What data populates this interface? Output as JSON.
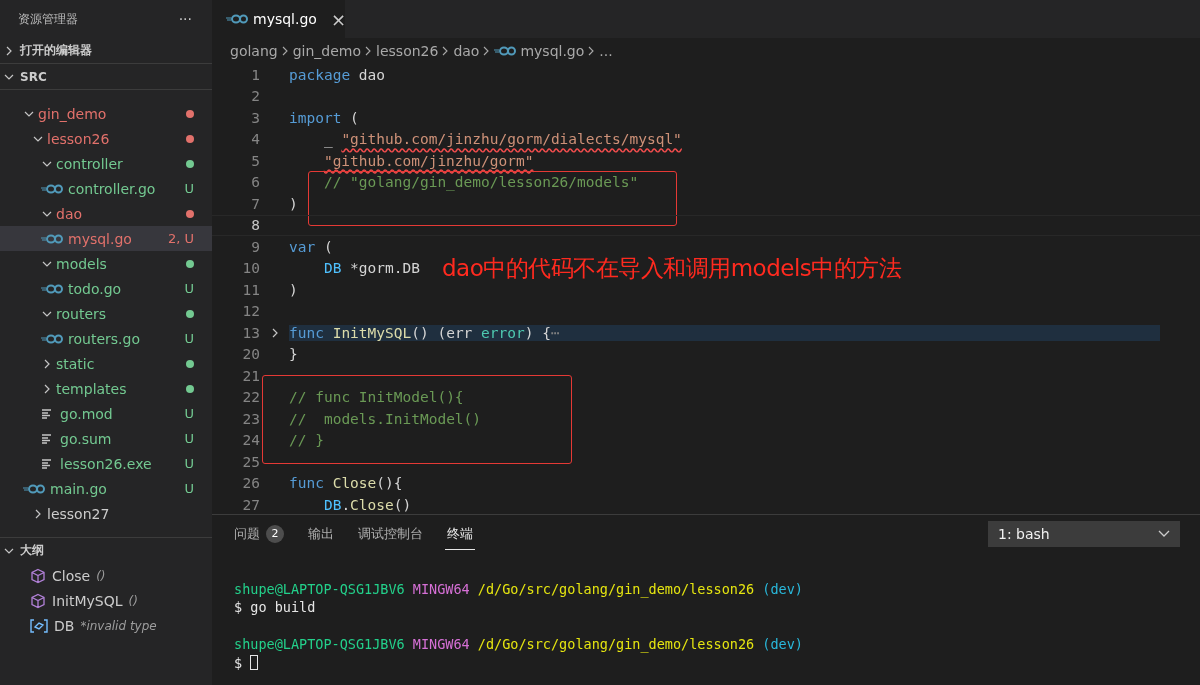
{
  "sidebar": {
    "title": "资源管理器",
    "more": "···",
    "sections": [
      {
        "label": "打开的编辑器",
        "expanded": false
      },
      {
        "label": "SRC",
        "expanded": true
      }
    ],
    "tree": [
      {
        "label": "gin_demo",
        "kind": "folder",
        "expanded": true,
        "color": "#e2716b",
        "dot": true,
        "children": [
          {
            "label": "lesson26",
            "kind": "folder",
            "expanded": true,
            "color": "#e2716b",
            "dot": true,
            "children": [
              {
                "label": "controller",
                "kind": "folder",
                "expanded": true,
                "color": "#73c991",
                "dot": true,
                "children": [
                  {
                    "label": "controller.go",
                    "kind": "go",
                    "color": "#73c991",
                    "badge": "U",
                    "selected": false
                  }
                ]
              },
              {
                "label": "dao",
                "kind": "folder",
                "expanded": true,
                "color": "#e2716b",
                "dot": true,
                "children": [
                  {
                    "label": "mysql.go",
                    "kind": "go",
                    "color": "#e2716b",
                    "badge": "2, U",
                    "selected": true
                  }
                ]
              },
              {
                "label": "models",
                "kind": "folder",
                "expanded": true,
                "color": "#73c991",
                "dot": true,
                "children": [
                  {
                    "label": "todo.go",
                    "kind": "go",
                    "color": "#73c991",
                    "badge": "U",
                    "selected": false
                  }
                ]
              },
              {
                "label": "routers",
                "kind": "folder",
                "expanded": true,
                "color": "#73c991",
                "dot": true,
                "children": [
                  {
                    "label": "routers.go",
                    "kind": "go",
                    "color": "#73c991",
                    "badge": "U",
                    "selected": false
                  }
                ]
              },
              {
                "label": "static",
                "kind": "folder",
                "expanded": false,
                "color": "#73c991",
                "dot": true
              },
              {
                "label": "templates",
                "kind": "folder",
                "expanded": false,
                "color": "#73c991",
                "dot": true
              },
              {
                "label": "go.mod",
                "kind": "file",
                "color": "#73c991",
                "badge": "U",
                "selected": false
              },
              {
                "label": "go.sum",
                "kind": "file",
                "color": "#73c991",
                "badge": "U",
                "selected": false
              },
              {
                "label": "lesson26.exe",
                "kind": "file",
                "color": "#73c991",
                "badge": "U",
                "selected": false
              }
            ]
          },
          {
            "label": "main.go",
            "kind": "go",
            "color": "#73c991",
            "badge": "U",
            "selected": false
          },
          {
            "label": "lesson27",
            "kind": "folder",
            "expanded": false
          }
        ]
      }
    ],
    "outline": {
      "label": "大纲",
      "expanded": true,
      "items": [
        {
          "name": "Close",
          "detail": "()",
          "kind": "method"
        },
        {
          "name": "InitMySQL",
          "detail": "()",
          "kind": "method"
        },
        {
          "name": "DB",
          "detail": "*invalid type",
          "kind": "variable"
        }
      ]
    }
  },
  "editor": {
    "tab": {
      "label": "mysql.go",
      "close": "×"
    },
    "breadcrumbs": [
      {
        "label": "golang",
        "kind": "folder"
      },
      {
        "label": "gin_demo",
        "kind": "folder"
      },
      {
        "label": "lesson26",
        "kind": "folder"
      },
      {
        "label": "dao",
        "kind": "folder"
      },
      {
        "label": "mysql.go",
        "kind": "go"
      },
      {
        "label": "...",
        "kind": "more"
      }
    ],
    "lines": [
      {
        "number": "1",
        "tokens": [
          {
            "text": "package",
            "kind": "keyword"
          },
          {
            "text": " dao",
            "kind": "plain"
          }
        ]
      },
      {
        "number": "2"
      },
      {
        "number": "3",
        "tokens": [
          {
            "text": "import",
            "kind": "keyword"
          },
          {
            "text": " (",
            "kind": "plain"
          }
        ]
      },
      {
        "number": "4",
        "indented": true,
        "tokens": [
          {
            "text": "_ ",
            "kind": "plain"
          },
          {
            "text": "\"github.com/jinzhu/gorm/dialects/mysql\"",
            "kind": "string",
            "error": true
          }
        ]
      },
      {
        "number": "5",
        "indented": true,
        "tokens": [
          {
            "text": "\"github.com/jinzhu/gorm\"",
            "kind": "string",
            "error": true
          }
        ]
      },
      {
        "number": "6",
        "boxed": true,
        "indented": true,
        "tokens": [
          {
            "text": "// \"golang/gin_demo/lesson26/models\"",
            "kind": "comment"
          }
        ]
      },
      {
        "number": "7",
        "boxed": true,
        "tokens": [
          {
            "text": ")",
            "kind": "plain"
          }
        ]
      },
      {
        "number": "8",
        "current": true
      },
      {
        "number": "9",
        "tokens": [
          {
            "text": "var",
            "kind": "keyword"
          },
          {
            "text": " (",
            "kind": "plain"
          }
        ]
      },
      {
        "number": "10",
        "indented": true,
        "tokens": [
          {
            "text": "DB",
            "kind": "variable"
          },
          {
            "text": " *gorm.DB",
            "kind": "plain"
          }
        ],
        "note": "dao中的代码不在导入和调用models中的方法"
      },
      {
        "number": "11",
        "tokens": [
          {
            "text": ")",
            "kind": "plain"
          }
        ]
      },
      {
        "number": "12"
      },
      {
        "number": "13",
        "folded": true,
        "tokens": [
          {
            "text": "func ",
            "kind": "keyword"
          },
          {
            "text": "InitMySQL",
            "kind": "function"
          },
          {
            "text": "() (err ",
            "kind": "plain"
          },
          {
            "text": "error",
            "kind": "type"
          },
          {
            "text": ") {",
            "kind": "plain"
          },
          {
            "text": "⋯",
            "kind": "ellipsis"
          }
        ]
      },
      {
        "number": "20",
        "tokens": [
          {
            "text": "}",
            "kind": "plain"
          }
        ]
      },
      {
        "number": "21",
        "boxed": true
      },
      {
        "number": "22",
        "boxed": true,
        "tokens": [
          {
            "text": "// func InitModel(){",
            "kind": "comment"
          }
        ]
      },
      {
        "number": "23",
        "boxed": true,
        "tokens": [
          {
            "text": "//  models.InitModel()",
            "kind": "comment"
          }
        ]
      },
      {
        "number": "24",
        "boxed": true,
        "tokens": [
          {
            "text": "// }",
            "kind": "comment"
          }
        ]
      },
      {
        "number": "25"
      },
      {
        "number": "26",
        "tokens": [
          {
            "text": "func ",
            "kind": "keyword"
          },
          {
            "text": "Close",
            "kind": "function"
          },
          {
            "text": "(){",
            "kind": "plain"
          }
        ]
      },
      {
        "number": "27",
        "indented": true,
        "tokens": [
          {
            "text": "DB",
            "kind": "variable"
          },
          {
            "text": ".",
            "kind": "plain"
          },
          {
            "text": "Close",
            "kind": "function"
          },
          {
            "text": "()",
            "kind": "plain"
          }
        ]
      }
    ]
  },
  "panel": {
    "tabs": [
      {
        "label": "问题",
        "count": "2",
        "selected": false
      },
      {
        "label": "输出",
        "selected": false
      },
      {
        "label": "调试控制台",
        "selected": false
      },
      {
        "label": "终端",
        "selected": true
      }
    ],
    "terminal_select": "1: bash",
    "terminal": [
      {
        "kind": "blank"
      },
      {
        "kind": "text",
        "segments": [
          {
            "text": "shupe@LAPTOP-QSG1JBV6",
            "kind": "user"
          },
          {
            "text": "MINGW64",
            "kind": "shell"
          },
          {
            "text": "/d/Go/src/golang/gin_demo/lesson26",
            "kind": "path"
          },
          {
            "text": "(dev)",
            "kind": "branch"
          }
        ]
      },
      {
        "kind": "text",
        "segments": [
          {
            "text": "$ go build",
            "kind": "plain"
          }
        ]
      },
      {
        "kind": "blank"
      },
      {
        "kind": "text",
        "segments": [
          {
            "text": "shupe@LAPTOP-QSG1JBV6",
            "kind": "user"
          },
          {
            "text": "MINGW64",
            "kind": "shell"
          },
          {
            "text": "/d/Go/src/golang/gin_demo/lesson26",
            "kind": "path"
          },
          {
            "text": "(dev)",
            "kind": "branch"
          }
        ]
      },
      {
        "kind": "text",
        "cursor": true,
        "segments": [
          {
            "text": "$",
            "kind": "plain"
          }
        ]
      }
    ]
  }
}
